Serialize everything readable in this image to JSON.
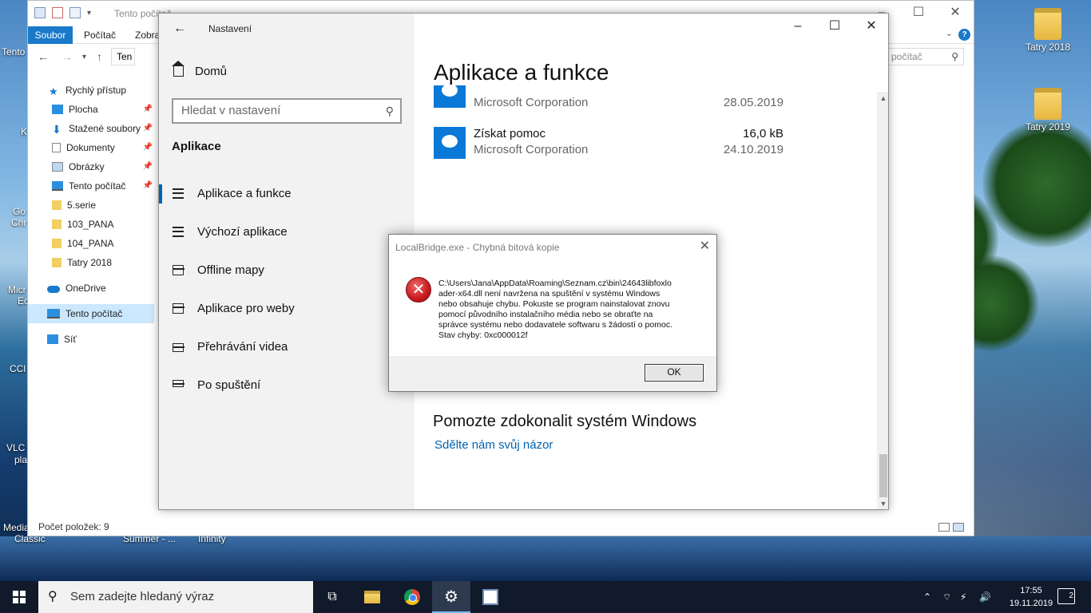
{
  "desktop": {
    "icons_right": [
      {
        "label": "Tatry 2018"
      },
      {
        "label": "Tatry 2019"
      }
    ],
    "left_clips": {
      "tento": "Tento",
      "k": "K",
      "go": "Go",
      "chr": "Chr",
      "micr": "Micr",
      "ec": "Ec",
      "ccl": "CCl",
      "vlc": "VLC",
      "pla": "pla",
      "media": "Media",
      "classic": "Classic"
    },
    "bottom_clips": {
      "summer": "Summer - ...",
      "infinity": "Infinity"
    }
  },
  "explorer": {
    "title": "Tento počítač",
    "ribbon_tabs": [
      "Soubor",
      "Počítač",
      "Zobra"
    ],
    "address": "Ten",
    "search_placeholder": "počítač",
    "nav": [
      {
        "label": "Rychlý přístup",
        "pinned": false
      },
      {
        "label": "Plocha",
        "pinned": true
      },
      {
        "label": "Stažené soubory",
        "pinned": true
      },
      {
        "label": "Dokumenty",
        "pinned": true
      },
      {
        "label": "Obrázky",
        "pinned": true
      },
      {
        "label": "Tento počítač",
        "pinned": true
      },
      {
        "label": "5.serie",
        "pinned": false
      },
      {
        "label": "103_PANA",
        "pinned": false
      },
      {
        "label": "104_PANA",
        "pinned": false
      },
      {
        "label": "Tatry 2018",
        "pinned": false
      },
      {
        "label": "OneDrive",
        "pinned": false
      },
      {
        "label": "Tento počítač",
        "pinned": false,
        "selected": true
      },
      {
        "label": "Síť",
        "pinned": false
      }
    ],
    "status": "Počet položek: 9"
  },
  "settings": {
    "app_title": "Nastavení",
    "home_label": "Domů",
    "search_placeholder": "Hledat v nastavení",
    "section_label": "Aplikace",
    "nav": [
      {
        "label": "Aplikace a funkce",
        "selected": true,
        "icon": "apps-features-icon"
      },
      {
        "label": "Výchozí aplikace",
        "selected": false,
        "icon": "default-apps-icon"
      },
      {
        "label": "Offline mapy",
        "selected": false,
        "icon": "offline-maps-icon"
      },
      {
        "label": "Aplikace pro weby",
        "selected": false,
        "icon": "apps-for-websites-icon"
      },
      {
        "label": "Přehrávání videa",
        "selected": false,
        "icon": "video-playback-icon"
      },
      {
        "label": "Po spuštění",
        "selected": false,
        "icon": "startup-icon"
      }
    ],
    "page_title": "Aplikace a funkce",
    "apps": [
      {
        "name": "",
        "publisher": "Microsoft Corporation",
        "size": "",
        "date": "28.05.2019"
      },
      {
        "name": "Získat pomoc",
        "publisher": "Microsoft Corporation",
        "size": "16,0 kB",
        "date": "24.10.2019"
      }
    ],
    "improve_title": "Pomozte zdokonalit systém Windows",
    "improve_link": "Sdělte nám svůj názor"
  },
  "dialog": {
    "title": "LocalBridge.exe - Chybná bitová kopie",
    "message": "C:\\Users\\Jana\\AppData\\Roaming\\Seznam.cz\\bin\\24643libfoxlo\nader-x64.dll není navržena na spuštění v systému Windows\nnebo obsahuje chybu. Pokuste se program nainstalovat znovu\npomocí původního instalačního média nebo se obraťte na\nsprávce systému nebo dodavatele softwaru s žádostí o pomoc.\nStav chyby: 0xc000012f",
    "ok_label": "OK"
  },
  "taskbar": {
    "search_placeholder": "Sem zadejte hledaný výraz",
    "time": "17:55",
    "date": "19.11.2019",
    "notification_count": "2",
    "accent": "#76b9ed"
  }
}
